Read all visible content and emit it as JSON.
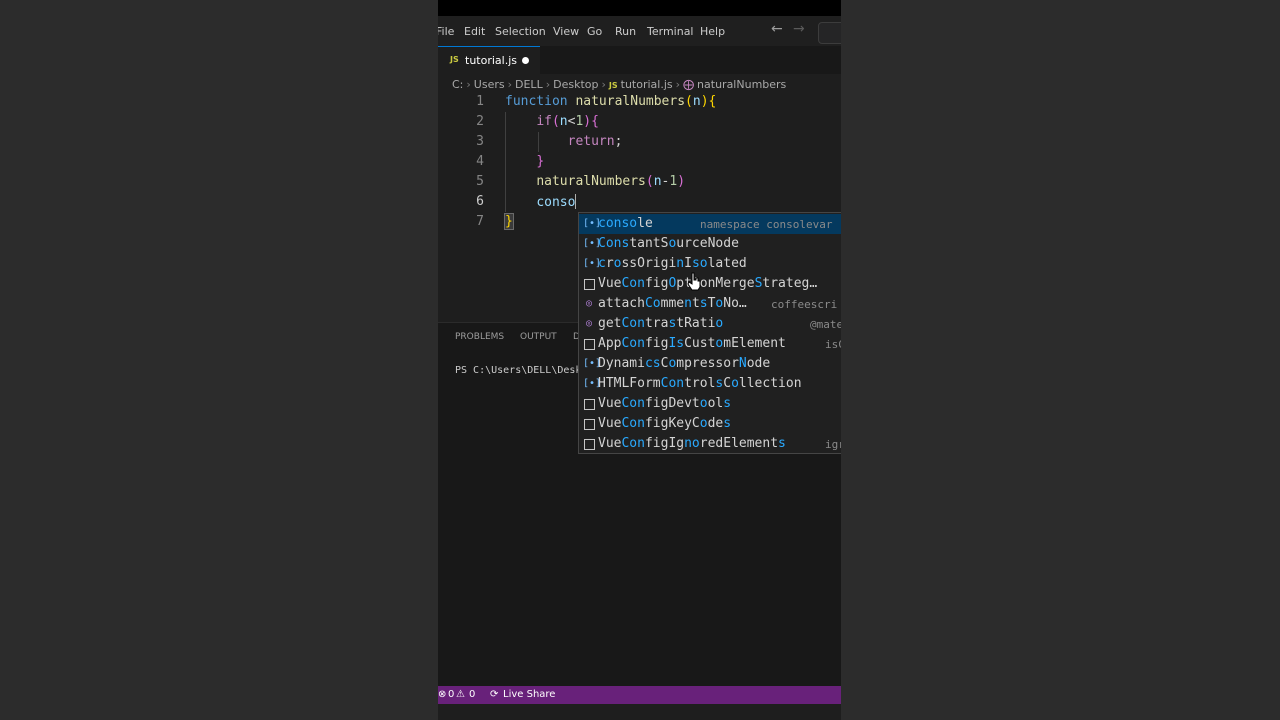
{
  "menubar": {
    "items": [
      "File",
      "Edit",
      "Selection",
      "View",
      "Go",
      "Run",
      "Terminal",
      "Help"
    ],
    "back_icon": "arrow-left-icon",
    "forward_icon": "arrow-right-icon"
  },
  "tab": {
    "badge": "JS",
    "label": "tutorial.js",
    "dirty": true
  },
  "breadcrumb": {
    "parts": [
      "C:",
      "Users",
      "DELL",
      "Desktop"
    ],
    "file_badge": "JS",
    "file": "tutorial.js",
    "symbol_icon": "function-symbol-icon",
    "symbol": "naturalNumbers"
  },
  "editor": {
    "line_numbers": [
      "1",
      "2",
      "3",
      "4",
      "5",
      "6",
      "7"
    ],
    "active_line": 6
  },
  "panel": {
    "tabs": [
      "PROBLEMS",
      "OUTPUT",
      "D"
    ],
    "terminal_text": "PS C:\\Users\\DELL\\Desk"
  },
  "suggest": {
    "items": [
      {
        "kind": "variable",
        "label": "console",
        "detail": "namespace consolevar"
      },
      {
        "kind": "variable",
        "label": "ConstantSourceNode",
        "detail": ""
      },
      {
        "kind": "variable",
        "label": "crossOriginIsolated",
        "detail": ""
      },
      {
        "kind": "keyword",
        "label": "VueConfigOptionMergeStrateg…",
        "detail": ""
      },
      {
        "kind": "method",
        "label": "attachCommentsToNo…",
        "detail": "coffeescri"
      },
      {
        "kind": "method",
        "label": "getContrastRatio",
        "detail": "@mate"
      },
      {
        "kind": "keyword",
        "label": "AppConfigIsCustomElement",
        "detail": "isC"
      },
      {
        "kind": "variable",
        "label": "DynamicsCompressorNode",
        "detail": ""
      },
      {
        "kind": "variable",
        "label": "HTMLFormControlsCollection",
        "detail": ""
      },
      {
        "kind": "keyword",
        "label": "VueConfigDevtools",
        "detail": ""
      },
      {
        "kind": "keyword",
        "label": "VueConfigKeyCodes",
        "detail": ""
      },
      {
        "kind": "keyword",
        "label": "VueConfigIgnoredElements",
        "detail": "igr"
      }
    ]
  },
  "statusbar": {
    "errors": "0",
    "warnings": "0",
    "live_share": "Live Share"
  },
  "colors": {
    "statusbar": "#68217a",
    "editor_bg": "#1e1e1e",
    "selection": "#04395e",
    "match_highlight": "#2aaaff"
  }
}
